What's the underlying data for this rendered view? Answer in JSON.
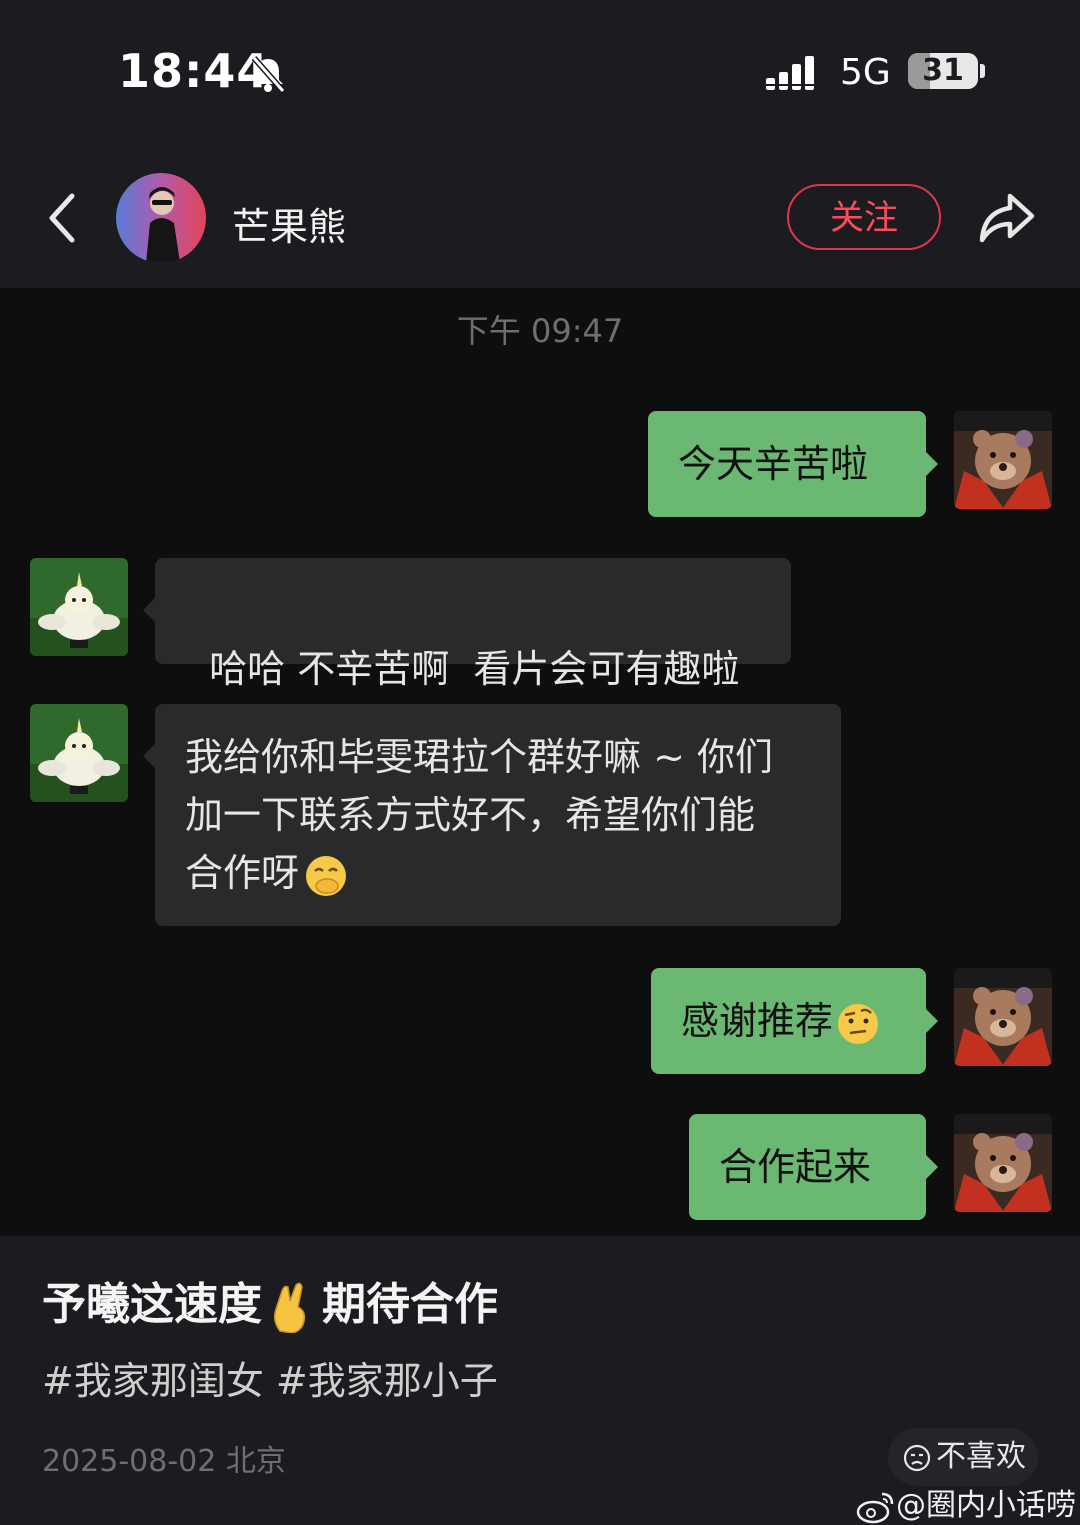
{
  "status_bar": {
    "time": "18:44",
    "network": "5G",
    "battery": "31",
    "battery_level_percent": 31,
    "icons": [
      "bell-muted-icon",
      "signal-icon"
    ]
  },
  "header": {
    "contact_name": "芒果熊",
    "follow_label": "关注",
    "icons": [
      "back-icon",
      "share-icon"
    ]
  },
  "chat": {
    "timestamp": "下午 09:47",
    "messages": [
      {
        "from": "me",
        "text": "今天辛苦啦"
      },
      {
        "from": "them",
        "text": "哈哈 不辛苦啊  看片会可有趣啦"
      },
      {
        "from": "them",
        "lines": [
          "我给你和毕雯珺拉个群好嘛 ~ 你们",
          "加一下联系方式好不，希望你们能",
          "合作呀"
        ],
        "emoji": "hand-over-mouth-emoji"
      },
      {
        "from": "me",
        "text": "感谢推荐",
        "emoji": "raised-eyebrow-emoji"
      },
      {
        "from": "me",
        "text": "合作起来"
      }
    ]
  },
  "caption": {
    "title_part1": "予曦这速度",
    "title_emoji": "crossed-fingers-emoji",
    "title_part2": "期待合作",
    "tags": "#我家那闺女 #我家那小子",
    "meta": "2025-08-02 北京",
    "dislike_label": "不喜欢",
    "watermark": "@圈内小话唠"
  },
  "colors": {
    "accent_red": "#e0364b",
    "bubble_me": "#6bb872",
    "bubble_them": "#2a2a2a",
    "chat_bg": "#0e0e0e",
    "header_bg": "#1c1c20"
  }
}
